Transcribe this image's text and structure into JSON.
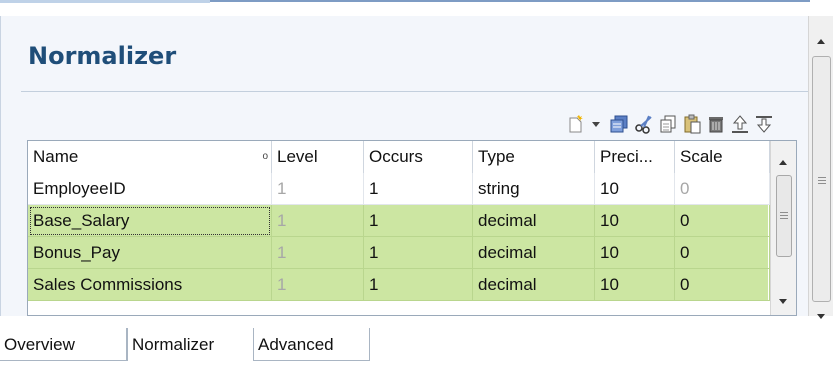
{
  "panel": {
    "title": "Normalizer"
  },
  "toolbar": {
    "icons": [
      "new-row-icon",
      "dropdown-arrow-icon",
      "copy-row-icon",
      "cut-icon",
      "copy-icon",
      "paste-icon",
      "delete-icon",
      "move-up-icon",
      "move-down-icon"
    ]
  },
  "table": {
    "columns": [
      "Name",
      "Level",
      "Occurs",
      "Type",
      "Preci...",
      "Scale"
    ],
    "rows": [
      {
        "name": "EmployeeID",
        "level": "1",
        "occurs": "1",
        "type": "string",
        "precision": "10",
        "scale": "0",
        "highlighted": false
      },
      {
        "name": "Base_Salary",
        "level": "1",
        "occurs": "1",
        "type": "decimal",
        "precision": "10",
        "scale": "0",
        "highlighted": true
      },
      {
        "name": "Bonus_Pay",
        "level": "1",
        "occurs": "1",
        "type": "decimal",
        "precision": "10",
        "scale": "0",
        "highlighted": true
      },
      {
        "name": "Sales Commissions",
        "level": "1",
        "occurs": "1",
        "type": "decimal",
        "precision": "10",
        "scale": "0",
        "highlighted": true
      }
    ]
  },
  "tabs": [
    "Overview",
    "Normalizer",
    "Advanced"
  ],
  "active_tab": "Normalizer",
  "colors": {
    "title": "#1f4e79",
    "row_highlight": "#cce6a2",
    "panel_bg": "#f3f6fb"
  }
}
